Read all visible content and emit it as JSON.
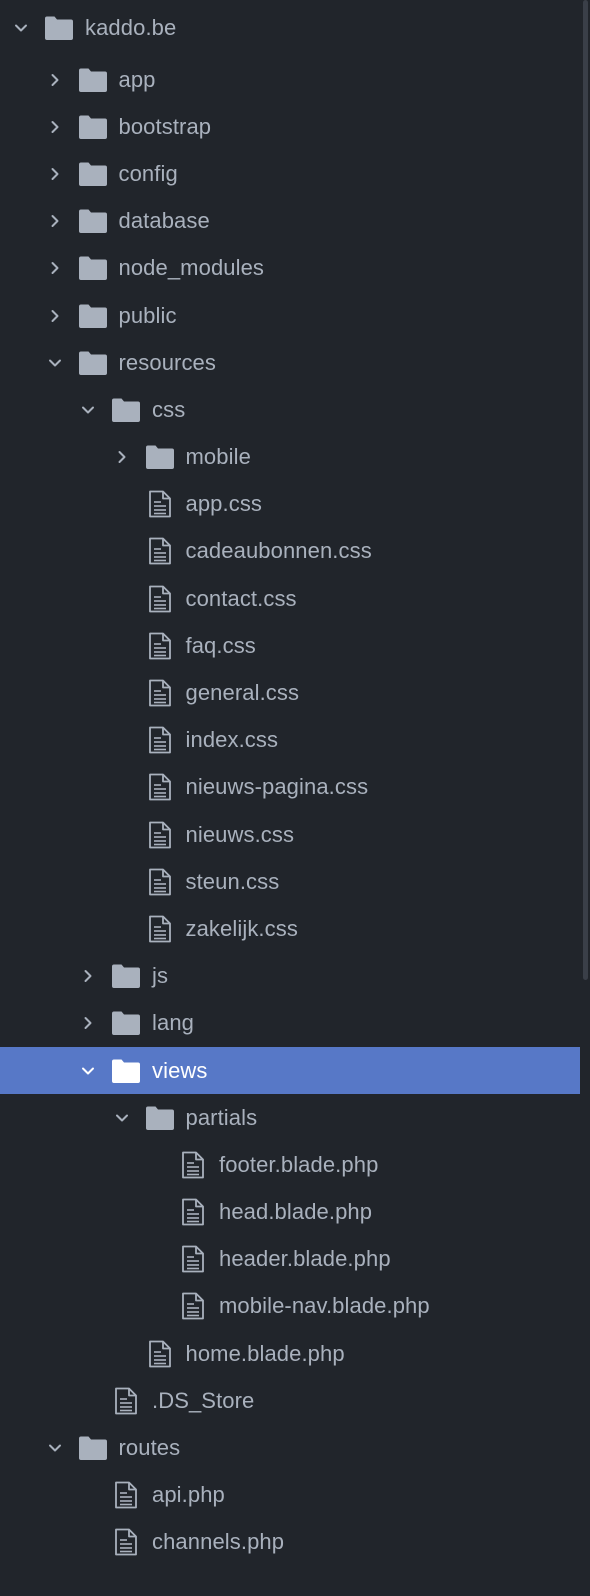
{
  "tree": {
    "items": [
      {
        "label": "kaddo.be",
        "type": "folder",
        "depth": 0,
        "expanded": true
      },
      {
        "label": "app",
        "type": "folder",
        "depth": 1,
        "expanded": false
      },
      {
        "label": "bootstrap",
        "type": "folder",
        "depth": 1,
        "expanded": false
      },
      {
        "label": "config",
        "type": "folder",
        "depth": 1,
        "expanded": false
      },
      {
        "label": "database",
        "type": "folder",
        "depth": 1,
        "expanded": false
      },
      {
        "label": "node_modules",
        "type": "folder",
        "depth": 1,
        "expanded": false
      },
      {
        "label": "public",
        "type": "folder",
        "depth": 1,
        "expanded": false
      },
      {
        "label": "resources",
        "type": "folder",
        "depth": 1,
        "expanded": true
      },
      {
        "label": "css",
        "type": "folder",
        "depth": 2,
        "expanded": true
      },
      {
        "label": "mobile",
        "type": "folder",
        "depth": 3,
        "expanded": false
      },
      {
        "label": "app.css",
        "type": "file",
        "depth": 3
      },
      {
        "label": "cadeaubonnen.css",
        "type": "file",
        "depth": 3
      },
      {
        "label": "contact.css",
        "type": "file",
        "depth": 3
      },
      {
        "label": "faq.css",
        "type": "file",
        "depth": 3
      },
      {
        "label": "general.css",
        "type": "file",
        "depth": 3
      },
      {
        "label": "index.css",
        "type": "file",
        "depth": 3
      },
      {
        "label": "nieuws-pagina.css",
        "type": "file",
        "depth": 3
      },
      {
        "label": "nieuws.css",
        "type": "file",
        "depth": 3
      },
      {
        "label": "steun.css",
        "type": "file",
        "depth": 3
      },
      {
        "label": "zakelijk.css",
        "type": "file",
        "depth": 3
      },
      {
        "label": "js",
        "type": "folder",
        "depth": 2,
        "expanded": false
      },
      {
        "label": "lang",
        "type": "folder",
        "depth": 2,
        "expanded": false
      },
      {
        "label": "views",
        "type": "folder",
        "depth": 2,
        "expanded": true,
        "selected": true
      },
      {
        "label": "partials",
        "type": "folder",
        "depth": 3,
        "expanded": true
      },
      {
        "label": "footer.blade.php",
        "type": "file",
        "depth": 4
      },
      {
        "label": "head.blade.php",
        "type": "file",
        "depth": 4
      },
      {
        "label": "header.blade.php",
        "type": "file",
        "depth": 4
      },
      {
        "label": "mobile-nav.blade.php",
        "type": "file",
        "depth": 4
      },
      {
        "label": "home.blade.php",
        "type": "file",
        "depth": 3
      },
      {
        "label": ".DS_Store",
        "type": "file",
        "depth": 2
      },
      {
        "label": "routes",
        "type": "folder",
        "depth": 1,
        "expanded": true
      },
      {
        "label": "api.php",
        "type": "file",
        "depth": 2
      },
      {
        "label": "channels.php",
        "type": "file",
        "depth": 2
      }
    ]
  },
  "colors": {
    "background": "#21252b",
    "text": "#a9b1bd",
    "icon": "#a9b1bd",
    "selected_background": "#5778c7",
    "selected_text": "#ffffff"
  },
  "icons": {
    "folder": "folder-icon",
    "file": "file-icon",
    "expanded": "chevron-down-icon",
    "collapsed": "chevron-right-icon"
  }
}
